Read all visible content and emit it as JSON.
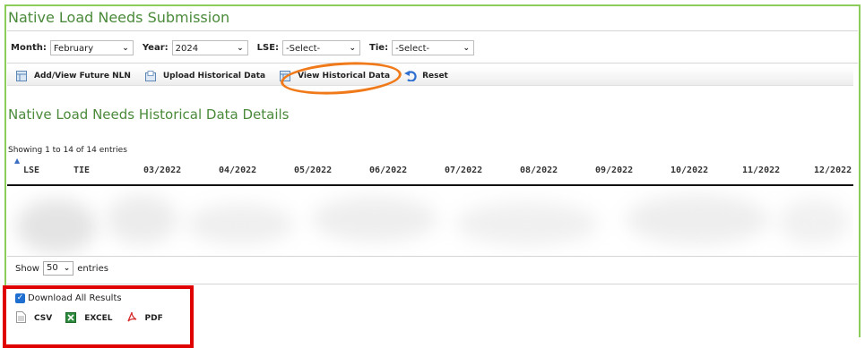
{
  "page": {
    "title": "Native Load Needs Submission"
  },
  "filters": {
    "month": {
      "label": "Month:",
      "value": "February"
    },
    "year": {
      "label": "Year:",
      "value": "2024"
    },
    "lse": {
      "label": "LSE:",
      "value": "-Select-"
    },
    "tie": {
      "label": "Tie:",
      "value": "-Select-"
    }
  },
  "toolbar": {
    "add_view": "Add/View Future NLN",
    "upload": "Upload Historical Data",
    "view_hist": "View Historical Data",
    "reset": "Reset"
  },
  "section": {
    "title": "Native Load Needs Historical Data Details"
  },
  "table": {
    "info": "Showing 1 to 14 of 14 entries",
    "columns": [
      "LSE",
      "TIE",
      "03/2022",
      "04/2022",
      "05/2022",
      "06/2022",
      "07/2022",
      "08/2022",
      "09/2022",
      "10/2022",
      "11/2022",
      "12/2022"
    ],
    "length": {
      "show": "Show",
      "value": "50",
      "entries": "entries"
    }
  },
  "download": {
    "checkbox_label": "Download All Results",
    "checked": true,
    "csv": "CSV",
    "excel": "EXCEL",
    "pdf": "PDF"
  },
  "annotations": {
    "highlight_color": "#e00000",
    "circle_color": "#f07a1a"
  },
  "colors": {
    "title_green": "#4a8a3a",
    "frame_green": "#8ccc5a",
    "checkbox_blue": "#1f6fd1"
  }
}
